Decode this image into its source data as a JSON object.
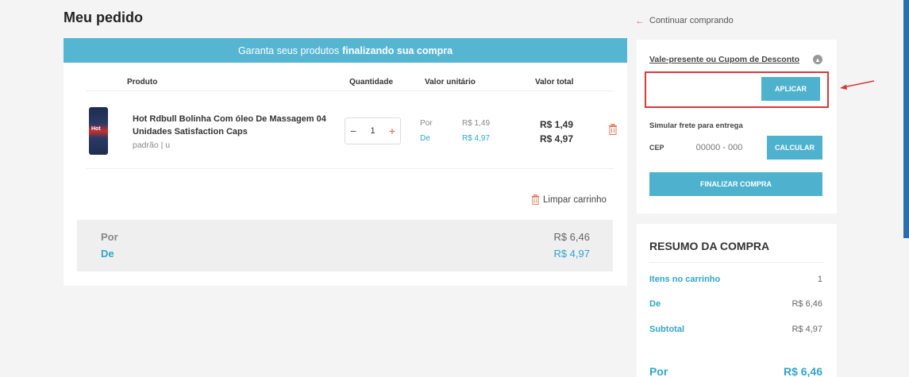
{
  "page": {
    "title": "Meu pedido",
    "continue_label": "Continuar comprando"
  },
  "banner": {
    "text_plain": "Garanta seus produtos",
    "text_bold": "finalizando sua compra"
  },
  "table": {
    "headers": {
      "product": "Produto",
      "quantity": "Quantidade",
      "unit": "Valor unitário",
      "total": "Valor total"
    }
  },
  "item": {
    "image_text": "Hot",
    "name": "Hot Rdbull Bolinha Com óleo De Massagem 04 Unidades Satisfaction Caps",
    "variant": "padrão  |  u",
    "quantity": "1",
    "unit_por_label": "Por",
    "unit_por_value": "R$ 1,49",
    "unit_de_label": "De",
    "unit_de_value": "R$ 4,97",
    "total_por": "R$ 1,49",
    "total_de": "R$ 4,97"
  },
  "clear_cart_label": "Limpar carrinho",
  "totals": {
    "por_label": "Por",
    "por_value": "R$ 6,46",
    "de_label": "De",
    "de_value": "R$ 4,97"
  },
  "coupon": {
    "title": "Vale-presente ou Cupom de Desconto",
    "input_value": "",
    "apply_label": "APLICAR",
    "freight_label": "Simular frete para entrega",
    "cep_label": "CEP",
    "cep_placeholder": "00000 - 000",
    "calc_label": "CALCULAR",
    "finish_label": "FINALIZAR COMPRA"
  },
  "summary": {
    "title": "RESUMO DA COMPRA",
    "rows": [
      {
        "label": "Itens no carrinho",
        "value": "1"
      },
      {
        "label": "De",
        "value": "R$ 6,46"
      },
      {
        "label": "Subtotal",
        "value": "R$ 4,97"
      }
    ],
    "total_label": "Por",
    "total_value": "R$ 6,46"
  },
  "colors": {
    "accent": "#4eb2cf",
    "highlight": "#d43a3a",
    "price_accent": "#e05a4a"
  },
  "icons": [
    "arrow-left-icon",
    "minus-icon",
    "plus-icon",
    "trash-icon",
    "chevron-up-icon",
    "red-pointer-arrow"
  ]
}
